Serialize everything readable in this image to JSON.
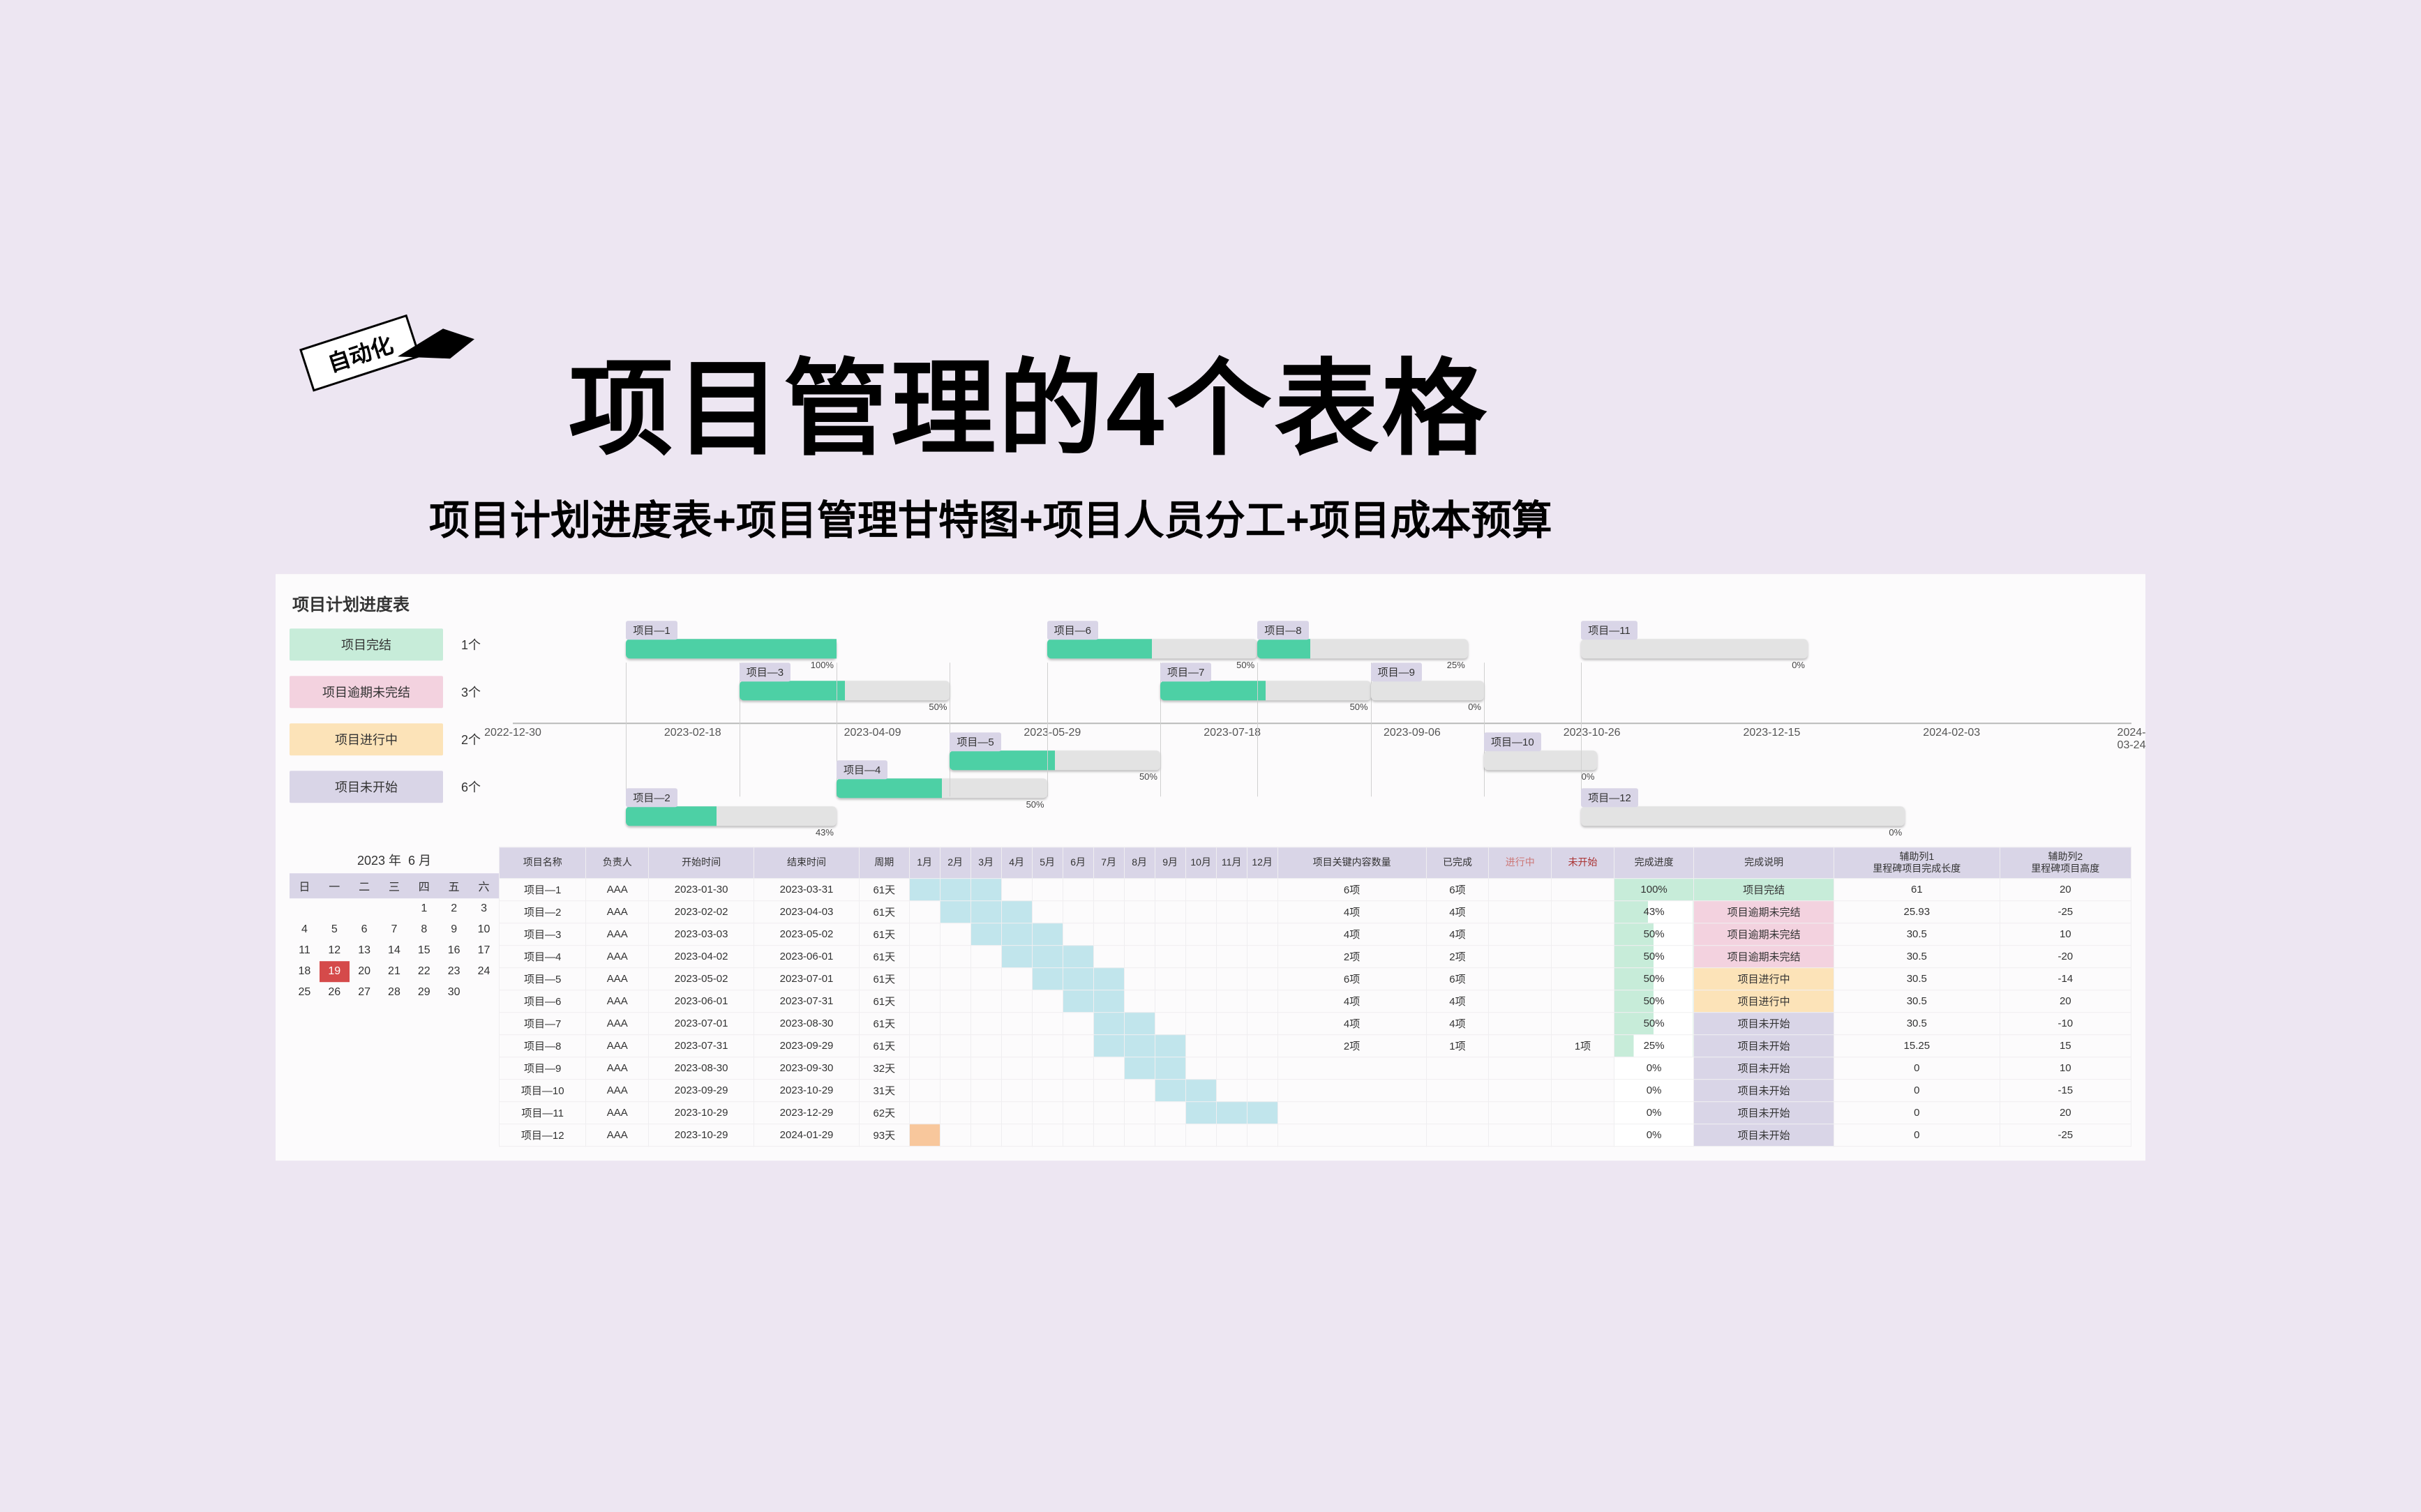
{
  "badge_text": "自动化",
  "title": "项目管理的4个表格",
  "subtitle": "项目计划进度表+项目管理甘特图+项目人员分工+项目成本预算",
  "panel_title": "项目计划进度表",
  "statuses": [
    {
      "label": "项目完结",
      "count": "1个",
      "cls": "s-done"
    },
    {
      "label": "项目逾期未完结",
      "count": "3个",
      "cls": "s-over"
    },
    {
      "label": "项目进行中",
      "count": "2个",
      "cls": "s-prog"
    },
    {
      "label": "项目未开始",
      "count": "6个",
      "cls": "s-not"
    }
  ],
  "axis_dates": [
    "2022-12-30",
    "2023-02-18",
    "2023-04-09",
    "2023-05-29",
    "2023-07-18",
    "2023-09-06",
    "2023-10-26",
    "2023-12-15",
    "2024-02-03",
    "2024-03-24"
  ],
  "bars": [
    {
      "name": "项目—1",
      "pct": "100%",
      "l": 7,
      "w": 13,
      "fill": 100,
      "row": 0,
      "top": true
    },
    {
      "name": "项目—2",
      "pct": "43%",
      "l": 7,
      "w": 13,
      "fill": 43,
      "row": 3,
      "top": false
    },
    {
      "name": "项目—3",
      "pct": "50%",
      "l": 14,
      "w": 13,
      "fill": 50,
      "row": 1,
      "top": true
    },
    {
      "name": "项目—4",
      "pct": "50%",
      "l": 20,
      "w": 13,
      "fill": 50,
      "row": 2,
      "top": false
    },
    {
      "name": "项目—5",
      "pct": "50%",
      "l": 27,
      "w": 13,
      "fill": 50,
      "row": 1,
      "top": false
    },
    {
      "name": "项目—6",
      "pct": "50%",
      "l": 33,
      "w": 13,
      "fill": 50,
      "row": 0,
      "top": true
    },
    {
      "name": "项目—7",
      "pct": "50%",
      "l": 40,
      "w": 13,
      "fill": 50,
      "row": 1,
      "top": true
    },
    {
      "name": "项目—8",
      "pct": "25%",
      "l": 46,
      "w": 13,
      "fill": 25,
      "row": 0,
      "top": true
    },
    {
      "name": "项目—9",
      "pct": "0%",
      "l": 53,
      "w": 7,
      "fill": 0,
      "row": 1,
      "top": true
    },
    {
      "name": "项目—10",
      "pct": "0%",
      "l": 60,
      "w": 7,
      "fill": 0,
      "row": 1,
      "top": false
    },
    {
      "name": "项目—11",
      "pct": "0%",
      "l": 66,
      "w": 14,
      "fill": 0,
      "row": 0,
      "top": true
    },
    {
      "name": "项目—12",
      "pct": "0%",
      "l": 66,
      "w": 20,
      "fill": 0,
      "row": 3,
      "top": false
    }
  ],
  "ym": {
    "year": "2023",
    "ylabel": "年",
    "month": "6",
    "mlabel": "月"
  },
  "cal_heads": [
    "日",
    "一",
    "二",
    "三",
    "四",
    "五",
    "六"
  ],
  "cal_rows": [
    [
      "",
      "",
      "",
      "",
      "1",
      "2",
      "3"
    ],
    [
      "4",
      "5",
      "6",
      "7",
      "8",
      "9",
      "10"
    ],
    [
      "11",
      "12",
      "13",
      "14",
      "15",
      "16",
      "17"
    ],
    [
      "18",
      "19",
      "20",
      "21",
      "22",
      "23",
      "24"
    ],
    [
      "25",
      "26",
      "27",
      "28",
      "29",
      "30",
      ""
    ]
  ],
  "today": "19",
  "tbl_heads": [
    "项目名称",
    "负责人",
    "开始时间",
    "结束时间",
    "周期"
  ],
  "months": [
    "1月",
    "2月",
    "3月",
    "4月",
    "5月",
    "6月",
    "7月",
    "8月",
    "9月",
    "10月",
    "11月",
    "12月"
  ],
  "tbl_heads2": {
    "key": "项目关键内容数量",
    "done": "已完成",
    "prog": "进行中",
    "not": "未开始",
    "pct": "完成进度",
    "stat": "完成说明",
    "aux1a": "辅助列1",
    "aux1b": "里程碑项目完成长度",
    "aux2a": "辅助列2",
    "aux2b": "里程碑项目高度"
  },
  "rows": [
    {
      "name": "项目—1",
      "owner": "AAA",
      "start": "2023-01-30",
      "end": "2023-03-31",
      "dur": "61天",
      "mstart": 1,
      "mend": 3,
      "key": "6项",
      "done": "6项",
      "prog": "",
      "not": "",
      "pct": "100%",
      "pcls": "p100",
      "stat": "项目完结",
      "scls": "st-done",
      "a1": "61",
      "a2": "20"
    },
    {
      "name": "项目—2",
      "owner": "AAA",
      "start": "2023-02-02",
      "end": "2023-04-03",
      "dur": "61天",
      "mstart": 2,
      "mend": 4,
      "key": "4项",
      "done": "4项",
      "prog": "",
      "not": "",
      "pct": "43%",
      "pcls": "p43",
      "stat": "项目逾期未完结",
      "scls": "st-over",
      "a1": "25.93",
      "a2": "-25"
    },
    {
      "name": "项目—3",
      "owner": "AAA",
      "start": "2023-03-03",
      "end": "2023-05-02",
      "dur": "61天",
      "mstart": 3,
      "mend": 5,
      "key": "4项",
      "done": "4项",
      "prog": "",
      "not": "",
      "pct": "50%",
      "pcls": "p50",
      "stat": "项目逾期未完结",
      "scls": "st-over",
      "a1": "30.5",
      "a2": "10"
    },
    {
      "name": "项目—4",
      "owner": "AAA",
      "start": "2023-04-02",
      "end": "2023-06-01",
      "dur": "61天",
      "mstart": 4,
      "mend": 6,
      "key": "2项",
      "done": "2项",
      "prog": "",
      "not": "",
      "pct": "50%",
      "pcls": "p50",
      "stat": "项目逾期未完结",
      "scls": "st-over",
      "a1": "30.5",
      "a2": "-20"
    },
    {
      "name": "项目—5",
      "owner": "AAA",
      "start": "2023-05-02",
      "end": "2023-07-01",
      "dur": "61天",
      "mstart": 5,
      "mend": 7,
      "key": "6项",
      "done": "6项",
      "prog": "",
      "not": "",
      "pct": "50%",
      "pcls": "p50",
      "stat": "项目进行中",
      "scls": "st-prog",
      "a1": "30.5",
      "a2": "-14"
    },
    {
      "name": "项目—6",
      "owner": "AAA",
      "start": "2023-06-01",
      "end": "2023-07-31",
      "dur": "61天",
      "mstart": 6,
      "mend": 7,
      "key": "4项",
      "done": "4项",
      "prog": "",
      "not": "",
      "pct": "50%",
      "pcls": "p50",
      "stat": "项目进行中",
      "scls": "st-prog",
      "a1": "30.5",
      "a2": "20"
    },
    {
      "name": "项目—7",
      "owner": "AAA",
      "start": "2023-07-01",
      "end": "2023-08-30",
      "dur": "61天",
      "mstart": 7,
      "mend": 8,
      "key": "4项",
      "done": "4项",
      "prog": "",
      "not": "",
      "pct": "50%",
      "pcls": "p50",
      "stat": "项目未开始",
      "scls": "st-not",
      "a1": "30.5",
      "a2": "-10"
    },
    {
      "name": "项目—8",
      "owner": "AAA",
      "start": "2023-07-31",
      "end": "2023-09-29",
      "dur": "61天",
      "mstart": 7,
      "mend": 9,
      "key": "2项",
      "done": "1项",
      "prog": "",
      "not": "1项",
      "pct": "25%",
      "pcls": "p25",
      "stat": "项目未开始",
      "scls": "st-not",
      "a1": "15.25",
      "a2": "15"
    },
    {
      "name": "项目—9",
      "owner": "AAA",
      "start": "2023-08-30",
      "end": "2023-09-30",
      "dur": "32天",
      "mstart": 8,
      "mend": 9,
      "key": "",
      "done": "",
      "prog": "",
      "not": "",
      "pct": "0%",
      "pcls": "p0",
      "stat": "项目未开始",
      "scls": "st-not",
      "a1": "0",
      "a2": "10"
    },
    {
      "name": "项目—10",
      "owner": "AAA",
      "start": "2023-09-29",
      "end": "2023-10-29",
      "dur": "31天",
      "mstart": 9,
      "mend": 10,
      "key": "",
      "done": "",
      "prog": "",
      "not": "",
      "pct": "0%",
      "pcls": "p0",
      "stat": "项目未开始",
      "scls": "st-not",
      "a1": "0",
      "a2": "-15"
    },
    {
      "name": "项目—11",
      "owner": "AAA",
      "start": "2023-10-29",
      "end": "2023-12-29",
      "dur": "62天",
      "mstart": 10,
      "mend": 12,
      "key": "",
      "done": "",
      "prog": "",
      "not": "",
      "pct": "0%",
      "pcls": "p0",
      "stat": "项目未开始",
      "scls": "st-not",
      "a1": "0",
      "a2": "20"
    },
    {
      "name": "项目—12",
      "owner": "AAA",
      "start": "2023-10-29",
      "end": "2024-01-29",
      "dur": "93天",
      "mstart": 0,
      "mend": 0,
      "mo": 1,
      "key": "",
      "done": "",
      "prog": "",
      "not": "",
      "pct": "0%",
      "pcls": "p0",
      "stat": "项目未开始",
      "scls": "st-not",
      "a1": "0",
      "a2": "-25"
    }
  ],
  "chart_data": {
    "type": "bar",
    "title": "项目计划进度表",
    "series": [
      {
        "name": "项目—1",
        "start": "2023-01-30",
        "end": "2023-03-31",
        "pct": 100
      },
      {
        "name": "项目—2",
        "start": "2023-02-02",
        "end": "2023-04-03",
        "pct": 43
      },
      {
        "name": "项目—3",
        "start": "2023-03-03",
        "end": "2023-05-02",
        "pct": 50
      },
      {
        "name": "项目—4",
        "start": "2023-04-02",
        "end": "2023-06-01",
        "pct": 50
      },
      {
        "name": "项目—5",
        "start": "2023-05-02",
        "end": "2023-07-01",
        "pct": 50
      },
      {
        "name": "项目—6",
        "start": "2023-06-01",
        "end": "2023-07-31",
        "pct": 50
      },
      {
        "name": "项目—7",
        "start": "2023-07-01",
        "end": "2023-08-30",
        "pct": 50
      },
      {
        "name": "项目—8",
        "start": "2023-07-31",
        "end": "2023-09-29",
        "pct": 25
      },
      {
        "name": "项目—9",
        "start": "2023-08-30",
        "end": "2023-09-30",
        "pct": 0
      },
      {
        "name": "项目—10",
        "start": "2023-09-29",
        "end": "2023-10-29",
        "pct": 0
      },
      {
        "name": "项目—11",
        "start": "2023-10-29",
        "end": "2023-12-29",
        "pct": 0
      },
      {
        "name": "项目—12",
        "start": "2023-10-29",
        "end": "2024-01-29",
        "pct": 0
      }
    ],
    "x_ticks": [
      "2022-12-30",
      "2023-02-18",
      "2023-04-09",
      "2023-05-29",
      "2023-07-18",
      "2023-09-06",
      "2023-10-26",
      "2023-12-15",
      "2024-02-03",
      "2024-03-24"
    ]
  }
}
